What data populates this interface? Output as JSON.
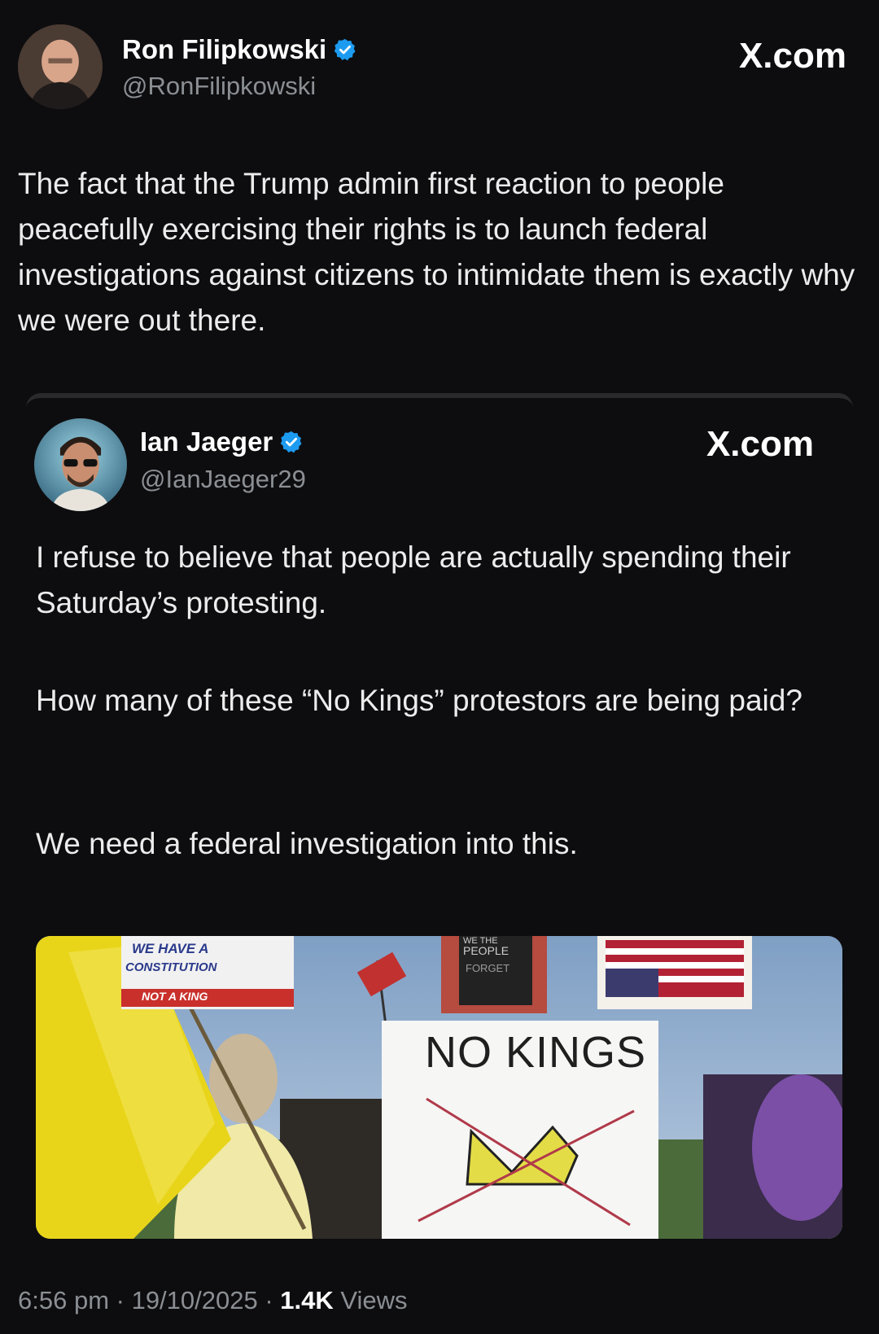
{
  "outer_post": {
    "author_name": "Ron Filipkowski",
    "author_handle": "@RonFilipkowski",
    "brand": "X.com",
    "text": "The fact that the Trump admin first reaction to people peacefully exercising their rights is to launch federal investigations against citizens to intimidate them is exactly why we were out there.",
    "verified_icon": "verified-badge-icon"
  },
  "quoted_post": {
    "author_name": "Ian Jaeger",
    "author_handle": "@IanJaeger29",
    "brand": "X.com",
    "text_p1": "I refuse to believe that people are actually spending their Saturday’s protesting.",
    "text_p2": "How many of these “No Kings” protestors are being paid?",
    "text_p3": "We need a federal investigation into this.",
    "media": {
      "sign_main": "NO KINGS",
      "sign_left_l1": "WE HAVE A",
      "sign_left_l2": "CONSTITUTION",
      "sign_left_l3": "NOT A KING",
      "sign_top_l1": "WE THE",
      "sign_top_l2": "PEOPLE",
      "sign_top_l3": "FORGET"
    }
  },
  "meta": {
    "time": "6:56 pm",
    "sep1": " · ",
    "date": "19/10/2025",
    "sep2": " · ",
    "views_count": "1.4K",
    "views_label": " Views"
  },
  "colors": {
    "background": "#0d0d0f",
    "verified": "#1d9bf0",
    "muted": "#8b8f94"
  }
}
